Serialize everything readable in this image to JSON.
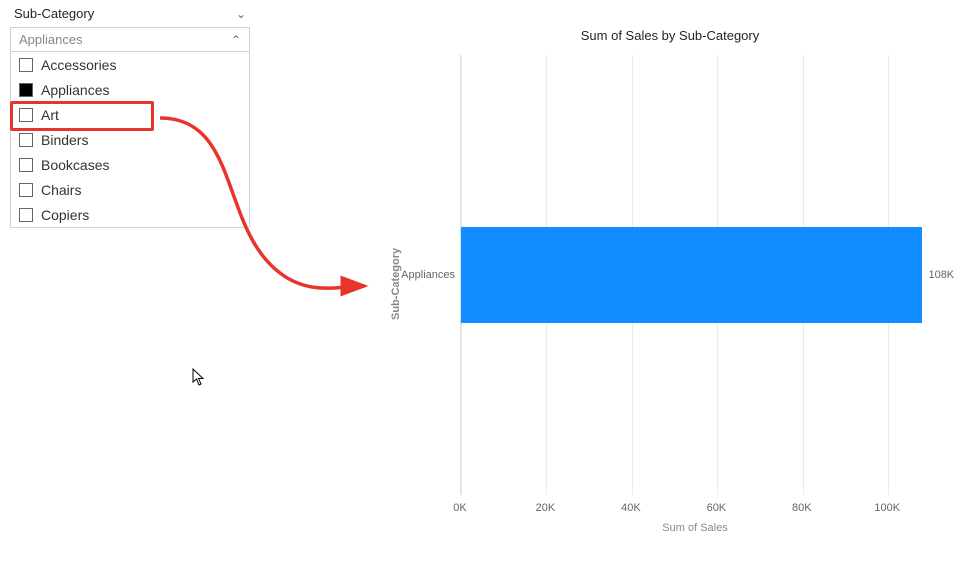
{
  "slicer": {
    "title": "Sub-Category",
    "selected_text": "Appliances",
    "items": [
      {
        "label": "Accessories",
        "checked": false
      },
      {
        "label": "Appliances",
        "checked": true
      },
      {
        "label": "Art",
        "checked": false
      },
      {
        "label": "Binders",
        "checked": false
      },
      {
        "label": "Bookcases",
        "checked": false
      },
      {
        "label": "Chairs",
        "checked": false
      },
      {
        "label": "Copiers",
        "checked": false
      }
    ]
  },
  "chart_data": {
    "type": "bar",
    "title": "Sum of Sales by Sub-Category",
    "xlabel": "Sum of Sales",
    "ylabel": "Sub-Category",
    "categories": [
      "Appliances"
    ],
    "values": [
      108000
    ],
    "value_labels": [
      "108K"
    ],
    "xlim": [
      0,
      110000
    ],
    "x_ticks": [
      0,
      20000,
      40000,
      60000,
      80000,
      100000
    ],
    "x_tick_labels": [
      "0K",
      "20K",
      "40K",
      "60K",
      "80K",
      "100K"
    ],
    "bar_color": "#118dff"
  }
}
